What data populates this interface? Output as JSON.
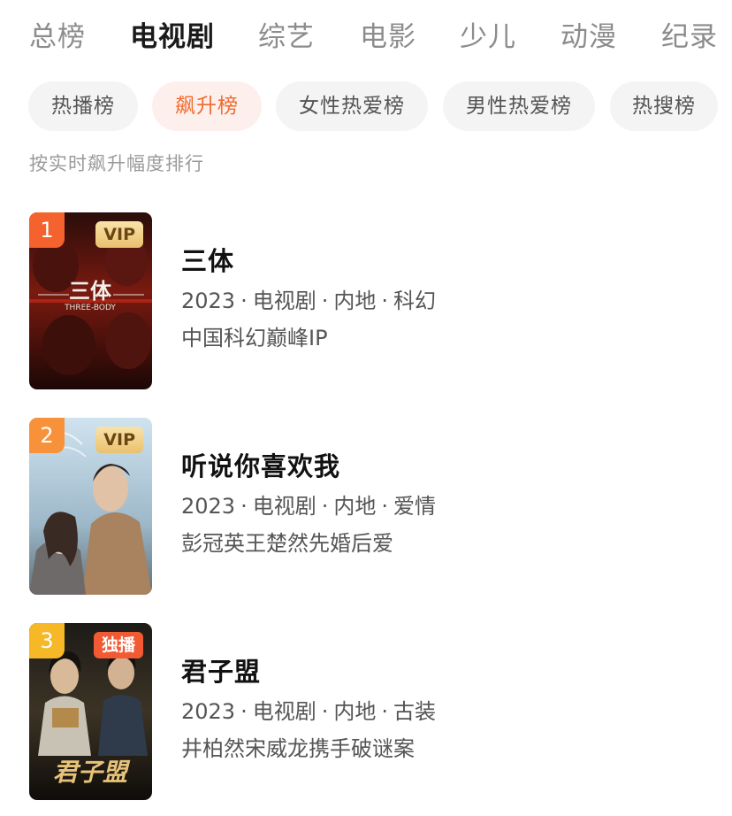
{
  "category_tabs": [
    "总榜",
    "电视剧",
    "综艺",
    "电影",
    "少儿",
    "动漫",
    "纪录"
  ],
  "active_category": "电视剧",
  "sub_tabs": [
    "热播榜",
    "飙升榜",
    "女性热爱榜",
    "男性热爱榜",
    "热搜榜"
  ],
  "active_sub_tab": "飙升榜",
  "hint": "按实时飙升幅度排行",
  "separator": "·",
  "colors": {
    "accent": "#f06a2e",
    "rank_1": "#f4622d",
    "rank_2": "#f7923a",
    "rank_3": "#f6b826",
    "vip_badge": "#e9c16f",
    "exclusive_badge": "#f15a33"
  },
  "items": [
    {
      "rank": "1",
      "badge": "VIP",
      "poster_text": "三体",
      "poster_subtext": "THREE-BODY",
      "title": "三体",
      "year": "2023",
      "genre": "电视剧",
      "region": "内地",
      "tag": "科幻",
      "desc": "中国科幻巅峰IP"
    },
    {
      "rank": "2",
      "badge": "VIP",
      "title": "听说你喜欢我",
      "year": "2023",
      "genre": "电视剧",
      "region": "内地",
      "tag": "爱情",
      "desc": "彭冠英王楚然先婚后爱"
    },
    {
      "rank": "3",
      "badge": "独播",
      "poster_text": "君子盟",
      "title": "君子盟",
      "year": "2023",
      "genre": "电视剧",
      "region": "内地",
      "tag": "古装",
      "desc": "井柏然宋威龙携手破谜案"
    }
  ]
}
